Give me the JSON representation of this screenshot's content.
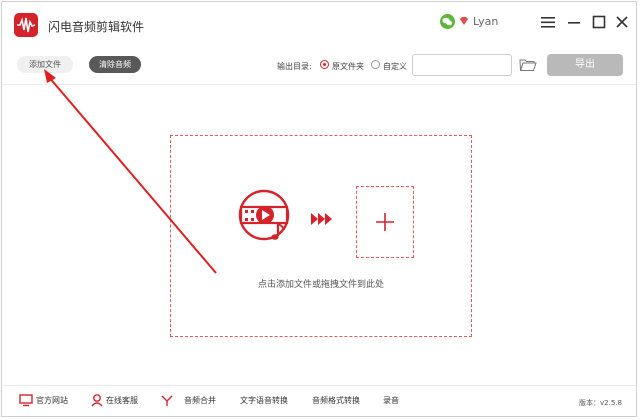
{
  "app": {
    "title": "闪电音频剪辑软件",
    "user": "Lyan",
    "accent": "#d4232b"
  },
  "toolbar": {
    "add_label": "添加文件",
    "clear_label": "清除音频",
    "output_label": "输出目录:",
    "options": [
      "原文件夹",
      "自定义"
    ],
    "selected": "原文件夹",
    "path_value": "",
    "export_label": "导出"
  },
  "dropzone": {
    "hint": "点击添加文件或拖拽文件到此处"
  },
  "footer": {
    "links": [
      "官方网站",
      "在线客服",
      "音频合并",
      "文字语音转换",
      "音频格式转换",
      "录音"
    ],
    "version": "版本：v2.5.8"
  },
  "icons": {
    "logo": "audio-wave-icon",
    "wechat": "wechat-icon",
    "vip": "vip-diamond-icon",
    "folder": "folder-icon",
    "media": "video-music-icon",
    "arrows": "triple-arrow-icon",
    "plus": "plus-icon",
    "annotation": "red-arrow-annotation"
  }
}
